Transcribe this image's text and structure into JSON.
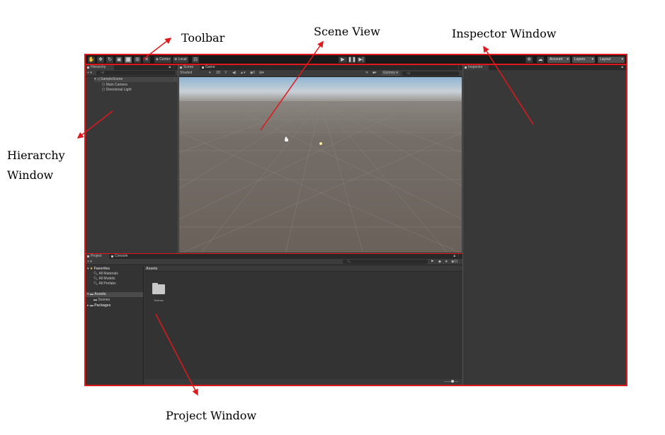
{
  "annotations": {
    "toolbar": "Toolbar",
    "scene_view": "Scene View",
    "inspector": "Inspector Window",
    "hierarchy_line1": "Hierarchy",
    "hierarchy_line2": "Window",
    "project": "Project Window"
  },
  "colors": {
    "highlight": "#e0181c",
    "panel": "#383838",
    "toolbar": "#191919",
    "sky_top": "#8eb4d2",
    "ground": "#6e6660"
  },
  "toolbar": {
    "tools": [
      "hand-icon",
      "move-icon",
      "rotate-icon",
      "scale-icon",
      "rect-icon",
      "transform-icon",
      "custom-tool-icon"
    ],
    "pivot_label": "Center",
    "space_label": "Local",
    "play_icons": [
      "play-icon",
      "pause-icon",
      "step-icon"
    ],
    "account_label": "Account",
    "layers_label": "Layers",
    "layout_label": "Layout"
  },
  "hierarchy": {
    "tab_label": "Hierarchy",
    "add_label": "+",
    "search_placeholder": "All",
    "scene_name": "SampleScene",
    "items": [
      {
        "label": "Main Camera"
      },
      {
        "label": "Directional Light"
      }
    ]
  },
  "scene": {
    "tabs": [
      {
        "label": "Scene"
      },
      {
        "label": "Game"
      }
    ],
    "shading_label": "Shaded",
    "mode_label": "2D",
    "gizmos_label": "Gizmos",
    "search_placeholder": "All"
  },
  "inspector": {
    "tab_label": "Inspector"
  },
  "project": {
    "tabs": [
      {
        "label": "Project"
      },
      {
        "label": "Console"
      }
    ],
    "add_label": "+",
    "favorites_label": "Favorites",
    "favorites": [
      {
        "label": "All Materials"
      },
      {
        "label": "All Models"
      },
      {
        "label": "All Prefabs"
      }
    ],
    "assets_label": "Assets",
    "asset_children": [
      {
        "label": "Scenes"
      }
    ],
    "packages_label": "Packages",
    "breadcrumb": "Assets",
    "hidden_count": "11",
    "files": [
      {
        "label": "Scenes"
      }
    ]
  }
}
